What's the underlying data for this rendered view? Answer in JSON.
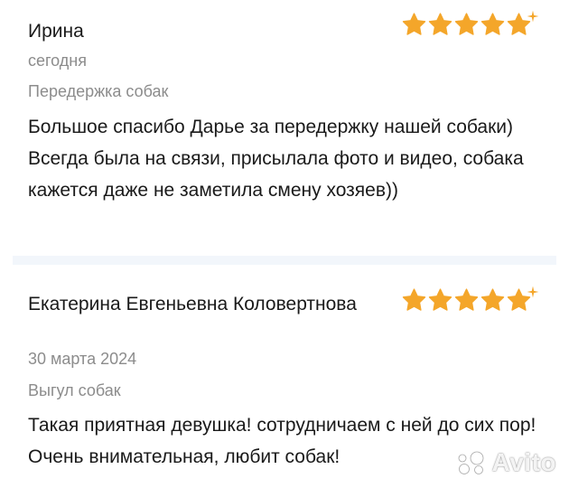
{
  "colors": {
    "star": "#f4a62a",
    "secondary_text": "#8c8c8c",
    "divider": "#f2f6fb"
  },
  "reviews": [
    {
      "author": "Ирина",
      "date": "сегодня",
      "service": "Передержка собак",
      "rating": 5,
      "text": "Большое спасибо Дарье за передержку нашей собаки) Всегда была на связи, присылала фото и видео, собака кажется даже не заметила смену хозяев))"
    },
    {
      "author": "Екатерина Евгеньевна Коловертнова",
      "date": "30 марта 2024",
      "service": "Выгул собак",
      "rating": 5,
      "text": "Такая приятная девушка! сотрудничаем с ней до сих пор! Очень внимательная, любит собак!"
    }
  ],
  "watermark": {
    "brand": "Avito",
    "icon": "avito-logo-icon"
  }
}
